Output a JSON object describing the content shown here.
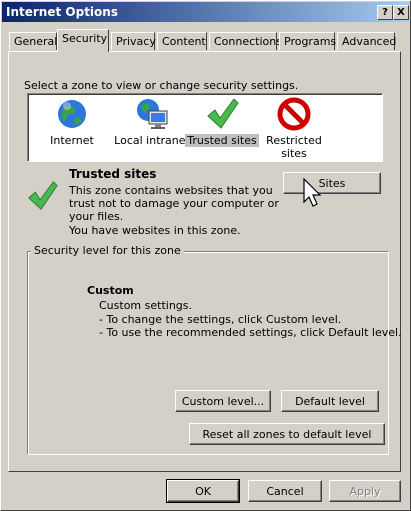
{
  "window": {
    "title": "Internet Options",
    "help_button": "?",
    "close_button": "X"
  },
  "tabs": [
    "General",
    "Security",
    "Privacy",
    "Content",
    "Connections",
    "Programs",
    "Advanced"
  ],
  "active_tab": "Security",
  "security": {
    "instruction": "Select a zone to view or change security settings.",
    "zones": [
      {
        "label": "Internet",
        "icon": "globe-icon"
      },
      {
        "label": "Local intranet",
        "icon": "intranet-icon"
      },
      {
        "label": "Trusted sites",
        "icon": "checkmark-icon",
        "selected": true
      },
      {
        "label": "Restricted sites",
        "icon": "prohibited-icon"
      }
    ],
    "zone_heading": "Trusted sites",
    "zone_description": [
      "This zone contains websites that you",
      "trust not to damage your computer or",
      "your files.",
      "You have websites in this zone."
    ],
    "sites_button": "Sites",
    "level_group_label": "Security level for this zone",
    "level_title": "Custom",
    "level_lines": [
      "Custom settings.",
      "- To change the settings, click Custom level.",
      "- To use the recommended settings, click Default level."
    ],
    "custom_level_button": "Custom level...",
    "default_level_button": "Default level",
    "reset_button": "Reset all zones to default level"
  },
  "footer": {
    "ok": "OK",
    "cancel": "Cancel",
    "apply": "Apply"
  },
  "colors": {
    "title_start": "#0a246a",
    "title_end": "#a6caf0",
    "face": "#d4d0c8",
    "check": "#4caf50",
    "prohibited": "#d10000"
  }
}
